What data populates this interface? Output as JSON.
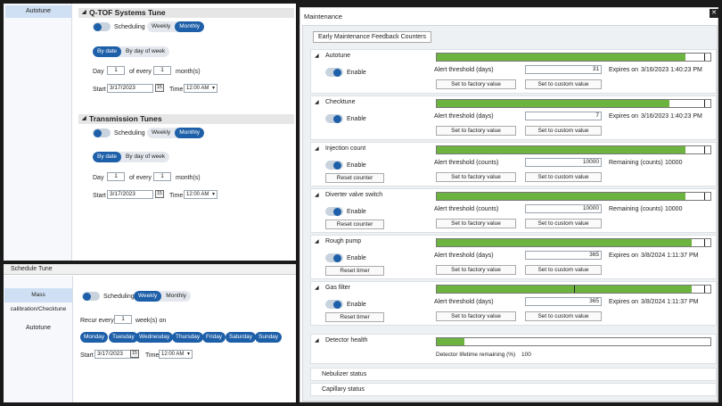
{
  "tune_panel": {
    "nav_selected": "Autotune",
    "sections": [
      {
        "title": "Q-TOF Systems Tune",
        "scheduling_label": "Scheduling",
        "freq_options": [
          "Weekly",
          "Monthly"
        ],
        "freq_selected": "Monthly",
        "mode_options": [
          "By date",
          "By day of week"
        ],
        "mode_selected": "By date",
        "day_label": "Day",
        "day_value": "1",
        "of_every_label": "of every",
        "months_value": "1",
        "months_label": "month(s)",
        "start_label": "Start",
        "start_value": "3/17/2023",
        "time_label": "Time",
        "time_value": "12:00 AM"
      },
      {
        "title": "Transmission Tunes",
        "scheduling_label": "Scheduling",
        "freq_options": [
          "Weekly",
          "Monthly"
        ],
        "freq_selected": "Monthly",
        "mode_options": [
          "By date",
          "By day of week"
        ],
        "mode_selected": "By date",
        "day_label": "Day",
        "day_value": "1",
        "of_every_label": "of every",
        "months_value": "1",
        "months_label": "month(s)",
        "start_label": "Start",
        "start_value": "3/17/2023",
        "time_label": "Time",
        "time_value": "12:00 AM"
      }
    ]
  },
  "schedule_tune": {
    "title": "Schedule Tune",
    "nav_items": [
      "Mass calibration/Checktune",
      "Autotune"
    ],
    "nav_selected": "Mass calibration/Checktune",
    "scheduling_label": "Scheduling",
    "freq_options": [
      "Weekly",
      "Monthly"
    ],
    "freq_selected": "Weekly",
    "recur_label": "Recur every",
    "recur_value": "1",
    "weeks_label": "week(s) on",
    "days": [
      "Monday",
      "Tuesday",
      "Wednesday",
      "Thursday",
      "Friday",
      "Saturday",
      "Sunday"
    ],
    "start_label": "Start",
    "start_value": "3/17/2023",
    "time_label": "Time",
    "time_value": "12:00 AM"
  },
  "maintenance": {
    "title": "Maintenance",
    "tab": "Early Maintenance Feedback Counters",
    "counters": [
      {
        "name": "Autotune",
        "enable": "Enable",
        "threshold_label": "Alert threshold (days)",
        "threshold": "31",
        "status_label": "Expires on",
        "status_value": "3/16/2023 1:40:23 PM",
        "btn_left": "Set to factory value",
        "btn_right": "Set to custom value",
        "fill": 0.91
      },
      {
        "name": "Checktune",
        "enable": "Enable",
        "threshold_label": "Alert threshold (days)",
        "threshold": "7",
        "status_label": "Expires on",
        "status_value": "3/16/2023 1:40:23 PM",
        "btn_left": "Set to factory value",
        "btn_right": "Set to custom value",
        "fill": 0.85
      },
      {
        "name": "Injection count",
        "enable": "Enable",
        "reset": "Reset counter",
        "threshold_label": "Alert threshold (counts)",
        "threshold": "10000",
        "status_label": "Remaining (counts)",
        "status_value": "10000",
        "btn_left": "Set to factory value",
        "btn_right": "Set to custom value",
        "fill": 0.91
      },
      {
        "name": "Diverter valve switch",
        "enable": "Enable",
        "reset": "Reset counter",
        "threshold_label": "Alert threshold (counts)",
        "threshold": "10000",
        "status_label": "Remaining (counts)",
        "status_value": "10000",
        "btn_left": "Set to factory value",
        "btn_right": "Set to custom value",
        "fill": 0.91
      },
      {
        "name": "Rough pump",
        "enable": "Enable",
        "reset": "Reset timer",
        "threshold_label": "Alert threshold (days)",
        "threshold": "365",
        "status_label": "Expires on",
        "status_value": "3/8/2024 1:11:37 PM",
        "btn_left": "Set to factory value",
        "btn_right": "Set to custom value",
        "fill": 0.93
      },
      {
        "name": "Gas filter",
        "enable": "Enable",
        "reset": "Reset timer",
        "threshold_label": "Alert threshold (days)",
        "threshold": "365",
        "status_label": "Expires on",
        "status_value": "3/8/2024 1:11:37 PM",
        "btn_left": "Set to factory value",
        "btn_right": "Set to custom value",
        "fill": 0.93
      }
    ],
    "detector": {
      "name": "Detector health",
      "label": "Detector lifetime remaining (%)",
      "value": "100",
      "fill": 0.1
    },
    "others": [
      "Nebulizer status",
      "Capillary status"
    ],
    "close": "✕"
  }
}
